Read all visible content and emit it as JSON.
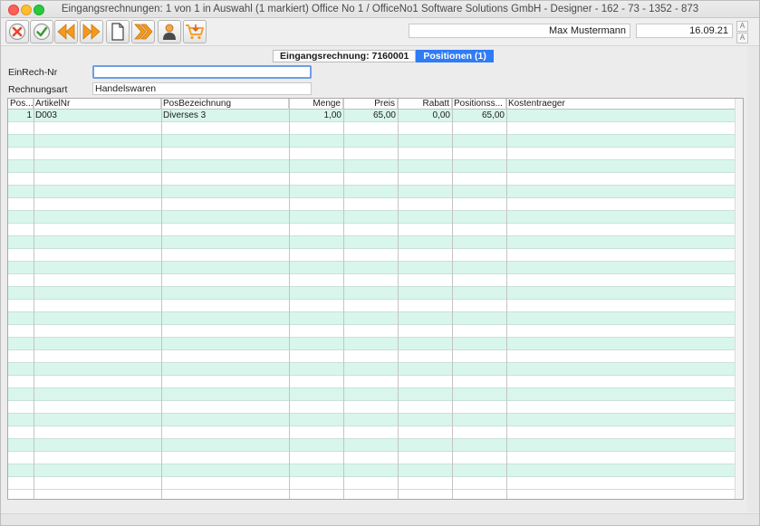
{
  "window": {
    "title": "Eingangsrechnungen: 1 von 1 in Auswahl  (1 markiert) Office No 1 /  OfficeNo1 Software Solutions GmbH - Designer - 162 - 73 - 1352 - 873"
  },
  "toolbar": {
    "buttons": [
      {
        "name": "cancel-button",
        "icon": "x-circle-icon"
      },
      {
        "name": "confirm-button",
        "icon": "checkmark-circle-icon"
      },
      {
        "name": "previous-button",
        "icon": "double-arrow-left-icon"
      },
      {
        "name": "next-button",
        "icon": "double-arrow-right-icon"
      },
      {
        "name": "new-document-button",
        "icon": "blank-page-icon"
      },
      {
        "name": "forward-button",
        "icon": "chevron-forward-icon"
      },
      {
        "name": "person-button",
        "icon": "person-icon"
      },
      {
        "name": "cart-button",
        "icon": "shopping-cart-icon"
      }
    ],
    "user": "Max Mustermann",
    "date": "16.09.21",
    "font_increase": "A",
    "font_decrease": "A"
  },
  "tabs": [
    {
      "label": "Eingangsrechnung: 7160001",
      "active": false
    },
    {
      "label": "Positionen (1)",
      "active": true
    }
  ],
  "form": {
    "einrech_label": "EinRech-Nr",
    "einrech_value": "",
    "rechnungsart_label": "Rechnungsart",
    "rechnungsart_value": "Handelswaren"
  },
  "table": {
    "columns": [
      "Pos...",
      "ArtikelNr",
      "PosBezeichnung",
      "Menge",
      "Preis",
      "Rabatt",
      "Positionss...",
      "Kostentraeger"
    ],
    "rows": [
      [
        "1",
        "D003",
        "Diverses 3",
        "1,00",
        "65,00",
        "0,00",
        "65,00",
        ""
      ]
    ],
    "empty_row_count": 29
  },
  "colors": {
    "stripe": "#d8f6eb",
    "accent": "#2f7cf6",
    "orange_icon": "#f39a1e"
  }
}
